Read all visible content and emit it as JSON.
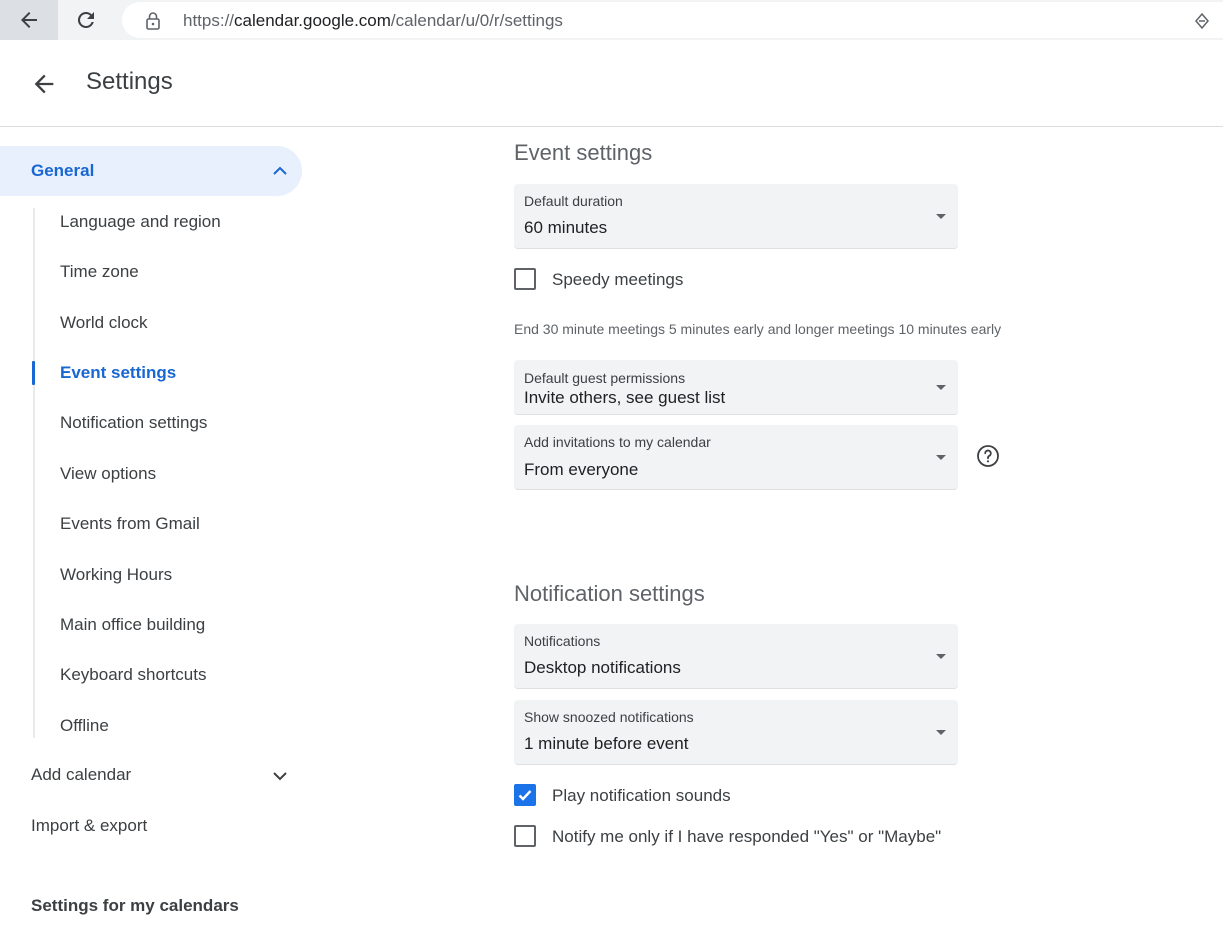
{
  "browser": {
    "url_prefix": "https://",
    "url_host": "calendar.google.com",
    "url_path": "/calendar/u/0/r/settings"
  },
  "header": {
    "title": "Settings"
  },
  "sidebar": {
    "general": "General",
    "sub_items": [
      "Language and region",
      "Time zone",
      "World clock",
      "Event settings",
      "Notification settings",
      "View options",
      "Events from Gmail",
      "Working Hours",
      "Main office building",
      "Keyboard shortcuts",
      "Offline"
    ],
    "add_calendar": "Add calendar",
    "import_export": "Import & export",
    "settings_for_my_calendars": "Settings for my calendars"
  },
  "event_settings": {
    "title": "Event settings",
    "default_duration": {
      "label": "Default duration",
      "value": "60 minutes"
    },
    "speedy_meetings": {
      "label": "Speedy meetings",
      "checked": false
    },
    "speedy_helper": "End 30 minute meetings 5 minutes early and longer meetings 10 minutes early",
    "guest_permissions": {
      "label": "Default guest permissions",
      "value": "Invite others, see guest list"
    },
    "add_invitations": {
      "label": "Add invitations to my calendar",
      "value": "From everyone"
    }
  },
  "notification_settings": {
    "title": "Notification settings",
    "notifications": {
      "label": "Notifications",
      "value": "Desktop notifications"
    },
    "snoozed": {
      "label": "Show snoozed notifications",
      "value": "1 minute before event"
    },
    "play_sounds": {
      "label": "Play notification sounds",
      "checked": true
    },
    "notify_responded": {
      "label": "Notify me only if I have responded \"Yes\" or \"Maybe\"",
      "checked": false
    }
  },
  "colors": {
    "accent": "#1a73e8",
    "active_text": "#1967d2",
    "active_bg": "#e8f0fe"
  }
}
